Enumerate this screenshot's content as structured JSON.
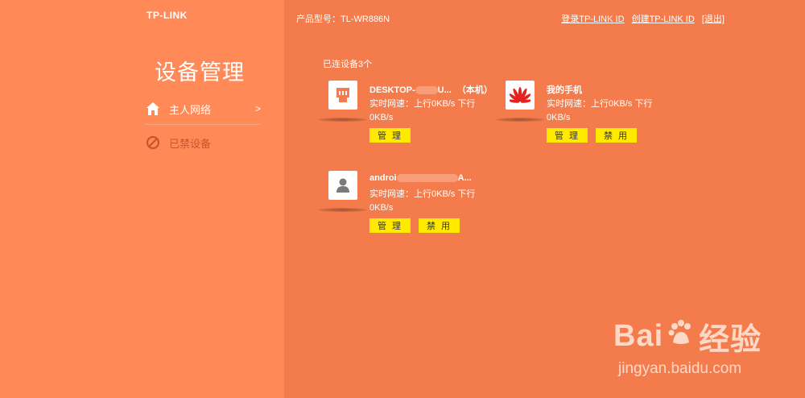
{
  "header": {
    "logo": "TP-LINK",
    "model": "产品型号：TL-WR886N",
    "links": [
      "登录TP-LINK ID",
      "创建TP-LINK ID",
      "[退出]"
    ]
  },
  "sidebar": {
    "title": "设备管理",
    "items": [
      {
        "label": "主人网络",
        "chevron": ">",
        "icon": "home-icon"
      },
      {
        "label": "已禁设备",
        "icon": "ban-icon"
      }
    ]
  },
  "main": {
    "connected_count": "已连设备3个",
    "devices": [
      {
        "name_prefix": "DESKTOP-",
        "name_suffix": "U...",
        "tag": "（本机）",
        "speed": "实时网速：上行0KB/s 下行0KB/s",
        "buttons": [
          "管 理"
        ],
        "icon": "router-icon"
      },
      {
        "name": "我的手机",
        "speed": "实时网速：上行0KB/s 下行0KB/s",
        "buttons": [
          "管 理",
          "禁 用"
        ],
        "icon": "huawei-logo-icon"
      },
      {
        "name_prefix": "androi",
        "name_suffix": "A...",
        "speed": "实时网速：上行0KB/s 下行0KB/s",
        "buttons": [
          "管 理",
          "禁 用"
        ],
        "icon": "user-icon"
      }
    ]
  },
  "watermark": {
    "main_prefix": "Bai",
    "main_suffix": "经验",
    "sub": "jingyan.baidu.com"
  }
}
